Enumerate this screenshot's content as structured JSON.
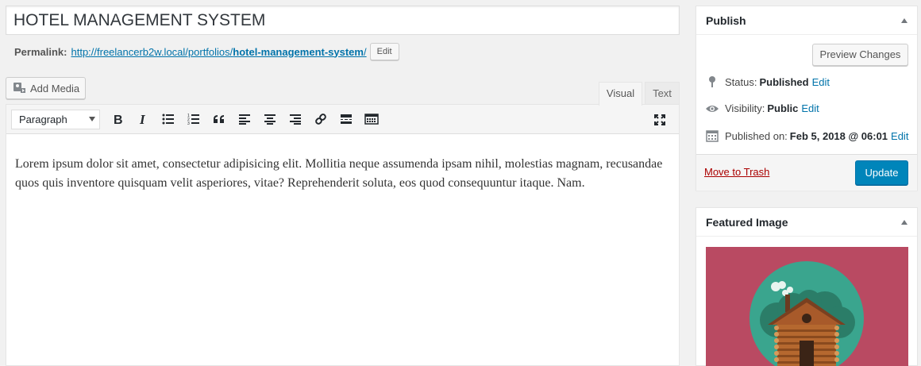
{
  "post": {
    "title": "HOTEL MANAGEMENT SYSTEM",
    "permalink_label": "Permalink:",
    "permalink_base": "http://freelancerb2w.local/portfolios/",
    "permalink_slug": "hotel-management-system",
    "permalink_trailing": "/",
    "permalink_edit": "Edit"
  },
  "editor": {
    "add_media_label": "Add Media",
    "tabs": [
      {
        "label": "Visual",
        "active": true
      },
      {
        "label": "Text",
        "active": false
      }
    ],
    "format_select": "Paragraph",
    "toolbar_icons": [
      "bold-icon",
      "italic-icon",
      "bullet-list-icon",
      "numbered-list-icon",
      "blockquote-icon",
      "align-left-icon",
      "align-center-icon",
      "align-right-icon",
      "link-icon",
      "read-more-icon",
      "toolbar-toggle-icon"
    ],
    "content": "Lorem ipsum dolor sit amet, consectetur adipisicing elit. Mollitia neque assumenda ipsam nihil, molestias magnam, recusandae quos quis inventore quisquam velit asperiores, vitae? Reprehenderit soluta, eos quod consequuntur itaque. Nam."
  },
  "publish": {
    "title": "Publish",
    "preview_label": "Preview Changes",
    "status_label": "Status:",
    "status_value": "Published",
    "visibility_label": "Visibility:",
    "visibility_value": "Public",
    "published_label": "Published on:",
    "published_value": "Feb 5, 2018 @ 06:01",
    "edit_label": "Edit",
    "trash_label": "Move to Trash",
    "update_label": "Update"
  },
  "featured": {
    "title": "Featured Image"
  },
  "colors": {
    "primary": "#0085ba",
    "link": "#0073aa",
    "trash": "#aa0000",
    "featured_bg": "#b94a62",
    "featured_circle": "#3aa58e"
  }
}
